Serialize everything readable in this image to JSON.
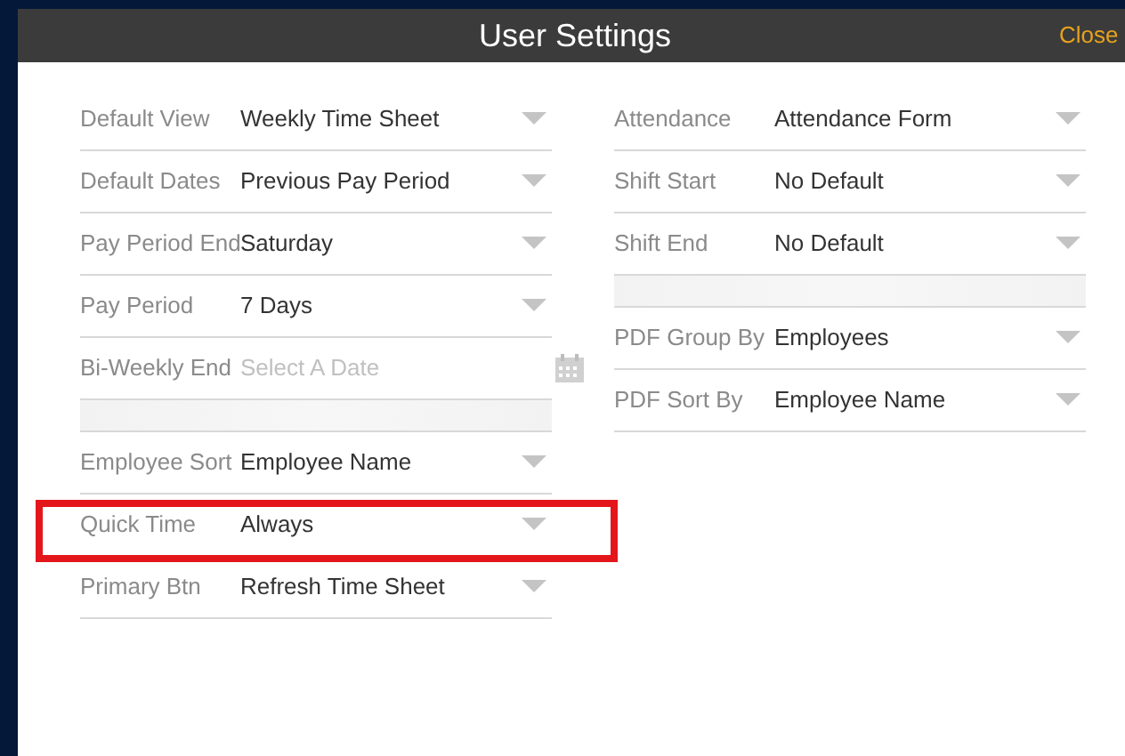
{
  "window": {
    "title": "User Settings",
    "close": "Close"
  },
  "columns": [
    {
      "rows": [
        {
          "kind": "select",
          "label": "Default View",
          "value": "Weekly Time Sheet",
          "highlighted": false
        },
        {
          "kind": "select",
          "label": "Default Dates",
          "value": "Previous Pay Period",
          "highlighted": false
        },
        {
          "kind": "select",
          "label": "Pay Period End",
          "value": "Saturday",
          "highlighted": false
        },
        {
          "kind": "select",
          "label": "Pay Period",
          "value": "7 Days",
          "highlighted": false
        },
        {
          "kind": "date",
          "label": "Bi-Weekly End",
          "placeholder": "Select A Date",
          "highlighted": false
        },
        {
          "kind": "spacer"
        },
        {
          "kind": "select",
          "label": "Employee Sort",
          "value": "Employee Name",
          "highlighted": false
        },
        {
          "kind": "select",
          "label": "Quick Time",
          "value": "Always",
          "highlighted": true
        },
        {
          "kind": "select",
          "label": "Primary Btn",
          "value": "Refresh Time Sheet",
          "highlighted": false
        }
      ]
    },
    {
      "rows": [
        {
          "kind": "select",
          "label": "Attendance",
          "value": "Attendance Form",
          "highlighted": false
        },
        {
          "kind": "select",
          "label": "Shift Start",
          "value": "No Default",
          "highlighted": false
        },
        {
          "kind": "select",
          "label": "Shift End",
          "value": "No Default",
          "highlighted": false
        },
        {
          "kind": "spacer"
        },
        {
          "kind": "select",
          "label": "PDF Group By",
          "value": "Employees",
          "highlighted": false
        },
        {
          "kind": "select",
          "label": "PDF Sort By",
          "value": "Employee Name",
          "highlighted": false
        }
      ]
    }
  ]
}
